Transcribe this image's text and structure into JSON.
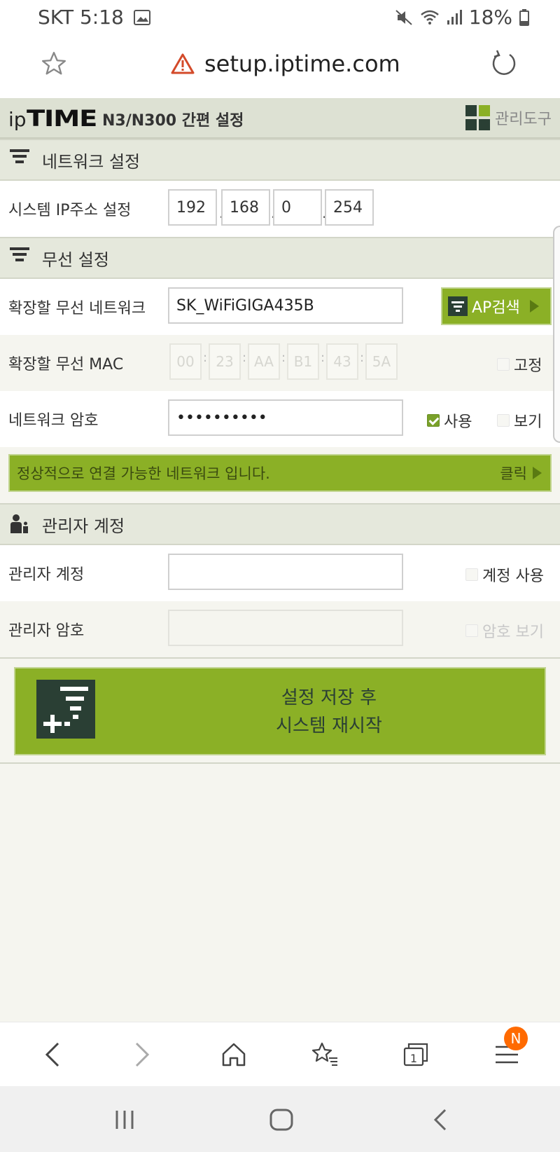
{
  "status": {
    "carrier_time": "SKT 5:18",
    "battery": "18%"
  },
  "browser": {
    "url": "setup.iptime.com"
  },
  "header": {
    "logo_ip": "ip",
    "logo_time": "TIME",
    "model": "N3/N300 간편 설정",
    "admin_tool": "관리도구"
  },
  "network": {
    "title": "네트워크 설정",
    "ip_label": "시스템 IP주소 설정",
    "ip": [
      "192",
      "168",
      "0",
      "254"
    ]
  },
  "wireless": {
    "title": "무선 설정",
    "ssid_label": "확장할 무선 네트워크",
    "ssid": "SK_WiFiGIGA435B",
    "ap_search": "AP검색",
    "mac_label": "확장할 무선 MAC",
    "mac": [
      "00",
      "23",
      "AA",
      "B1",
      "43",
      "5A"
    ],
    "fixed_label": "고정",
    "password_label": "네트워크 암호",
    "password_mask": "••••••••••",
    "use_label": "사용",
    "show_label": "보기",
    "notice": "정상적으로 연결 가능한 네트워크 입니다.",
    "click": "클릭"
  },
  "admin": {
    "title": "관리자 계정",
    "account_label": "관리자 계정",
    "account_use": "계정 사용",
    "password_label": "관리자 암호",
    "password_show": "암호 보기"
  },
  "save": {
    "line1": "설정 저장 후",
    "line2": "시스템 재시작"
  },
  "toolbar": {
    "badge": "N",
    "tabs_count": "1"
  },
  "colors": {
    "green": "#8bb026",
    "dark": "#2a3f34",
    "header_bg": "#dde1d3"
  }
}
